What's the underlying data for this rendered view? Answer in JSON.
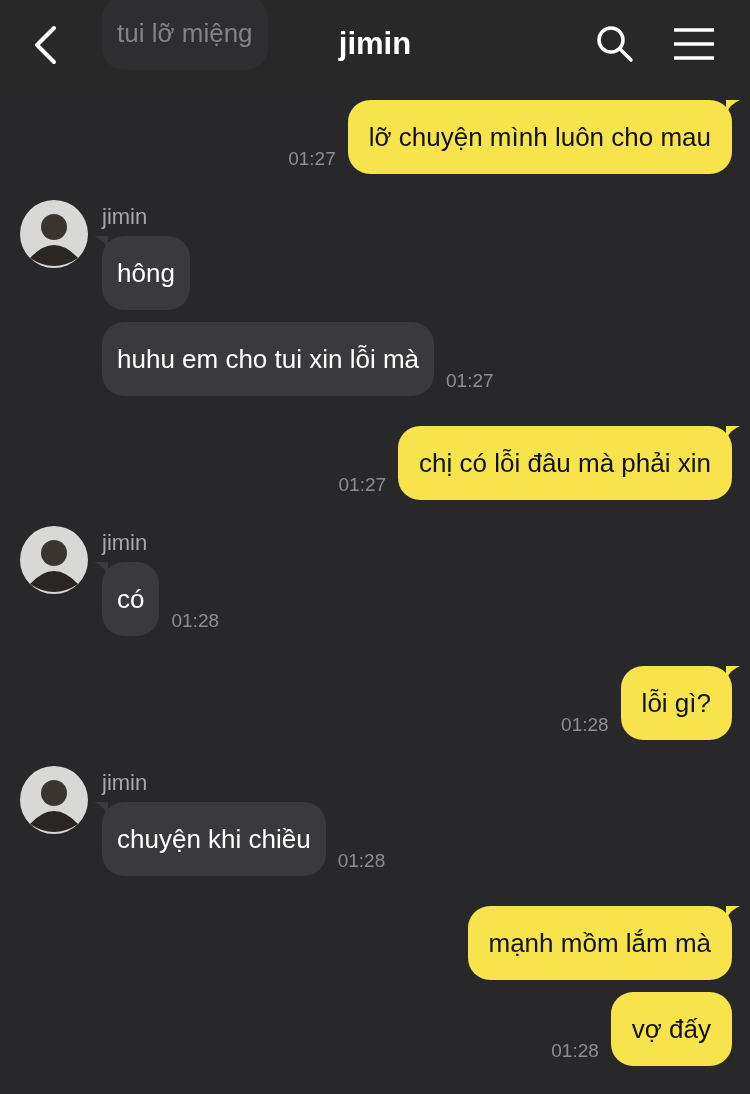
{
  "header": {
    "title": "jimin"
  },
  "groups": [
    {
      "kind": "incoming",
      "faded": true,
      "bubbles": [
        {
          "text": "tui lỡ miệng"
        }
      ]
    },
    {
      "kind": "outgoing",
      "bubbles": [
        {
          "text": "lỡ chuyện mình luôn cho mau",
          "time": "01:27"
        }
      ]
    },
    {
      "kind": "incoming",
      "sender": "jimin",
      "faded": false,
      "bubbles": [
        {
          "text": "hông"
        },
        {
          "text": "huhu em cho tui xin lỗi mà",
          "time": "01:27"
        }
      ]
    },
    {
      "kind": "outgoing",
      "bubbles": [
        {
          "text": "chị có lỗi đâu mà phải xin",
          "time": "01:27"
        }
      ]
    },
    {
      "kind": "incoming",
      "sender": "jimin",
      "faded": false,
      "bubbles": [
        {
          "text": "có",
          "time": "01:28"
        }
      ]
    },
    {
      "kind": "outgoing",
      "bubbles": [
        {
          "text": "lỗi gì?",
          "time": "01:28"
        }
      ]
    },
    {
      "kind": "incoming",
      "sender": "jimin",
      "faded": false,
      "bubbles": [
        {
          "text": "chuyện khi chiều",
          "time": "01:28"
        }
      ]
    },
    {
      "kind": "outgoing",
      "bubbles": [
        {
          "text": "mạnh mồm lắm mà"
        },
        {
          "text": "vợ đấy",
          "time": "01:28"
        }
      ]
    }
  ]
}
